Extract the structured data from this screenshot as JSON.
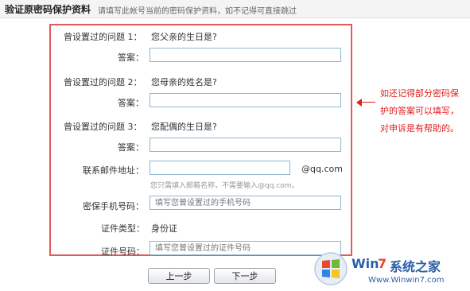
{
  "header": {
    "title": "验证原密码保护资料",
    "hint": "请填写此帐号当前的密码保护资料，如不记得可直接跳过"
  },
  "form": {
    "q1": {
      "label": "曾设置过的问题 1：",
      "question": "您父亲的生日是?",
      "answer_label": "答案：",
      "answer_value": ""
    },
    "q2": {
      "label": "曾设置过的问题 2：",
      "question": "您母亲的姓名是?",
      "answer_label": "答案：",
      "answer_value": ""
    },
    "q3": {
      "label": "曾设置过的问题 3：",
      "question": "您配偶的生日是?",
      "answer_label": "答案：",
      "answer_value": ""
    },
    "email": {
      "label": "联系邮件地址：",
      "value": "",
      "suffix": "@qq.com",
      "note": "您只需填入邮箱名称，不需要输入@qq.com。"
    },
    "phone": {
      "label": "密保手机号码：",
      "placeholder": "填写您曾设置过的手机号码"
    },
    "id_type": {
      "label": "证件类型：",
      "value": "身份证"
    },
    "id_number": {
      "label": "证件号码：",
      "placeholder": "填写您曾设置过的证件号码"
    }
  },
  "buttons": {
    "prev": "上一步",
    "next": "下一步"
  },
  "annotation": "如还记得部分密码保护的答案可以填写，对申诉是有帮助的。",
  "watermark": {
    "brand_win": "Win",
    "brand_seven": "7",
    "brand_rest": "系统之家",
    "url": "Www.Winwin7.com"
  },
  "colors": {
    "box_border": "#e35a5a",
    "annotation": "#e02020",
    "input_border": "#8eb8cf",
    "watermark": "#2a5fa8"
  }
}
